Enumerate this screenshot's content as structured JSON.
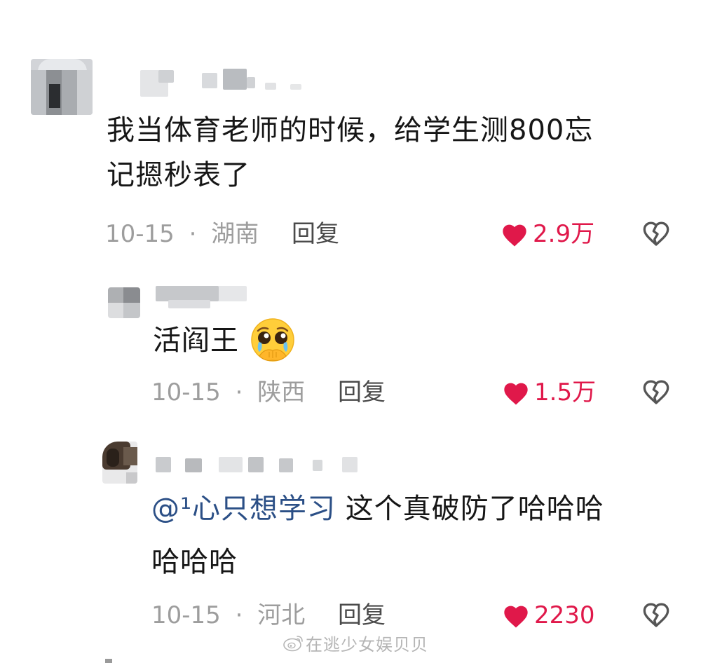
{
  "comments": [
    {
      "text_line1": "我当体育老师的时候，给学生测800忘",
      "text_line2": "记摁秒表了",
      "date": "10-15",
      "separator": "·",
      "location": "湖南",
      "reply_label": "回复",
      "likes": "2.9万"
    },
    {
      "text": "活阎王",
      "emoji": "pleading-face-emoji",
      "date": "10-15",
      "separator": "·",
      "location": "陕西",
      "reply_label": "回复",
      "likes": "1.5万"
    },
    {
      "mention": "@¹心只想学习",
      "text_line1": " 这个真破防了哈哈哈",
      "text_line2": "哈哈哈",
      "date": "10-15",
      "separator": "·",
      "location": "河北",
      "reply_label": "回复",
      "likes": "2230"
    }
  ],
  "watermark": "在逃少女娱贝贝",
  "colors": {
    "like_red": "#e0184a",
    "mention_blue": "#2b4f86",
    "meta_gray": "#9d9d9d"
  },
  "icons": [
    "heart-icon",
    "broken-heart-icon",
    "weibo-icon"
  ]
}
